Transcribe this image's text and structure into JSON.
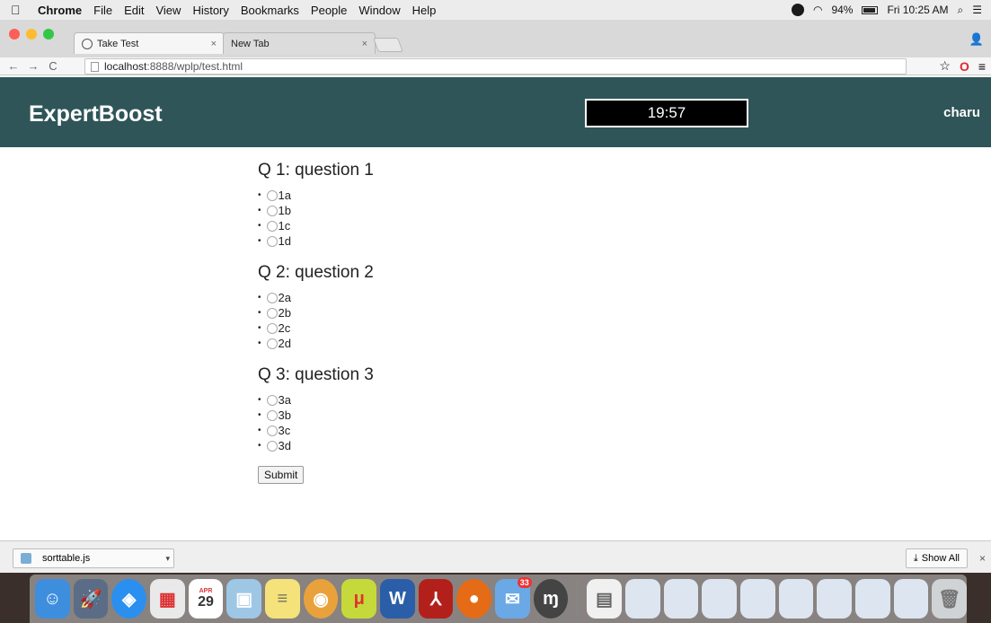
{
  "menubar": {
    "apple": "",
    "app": "Chrome",
    "items": [
      "File",
      "Edit",
      "View",
      "History",
      "Bookmarks",
      "People",
      "Window",
      "Help"
    ],
    "battery": "94%",
    "clock": "Fri 10:25 AM"
  },
  "tabs": [
    {
      "label": "Take Test",
      "close": "×"
    },
    {
      "label": "New Tab",
      "close": "×"
    }
  ],
  "omnibox": {
    "host": "localhost",
    "path": ":8888/wplp/test.html"
  },
  "site": {
    "brand": "ExpertBoost",
    "timer": "19:57",
    "user": "charu"
  },
  "questions": [
    {
      "title": "Q 1: question 1",
      "options": [
        "1a",
        "1b",
        "1c",
        "1d"
      ]
    },
    {
      "title": "Q 2: question 2",
      "options": [
        "2a",
        "2b",
        "2c",
        "2d"
      ]
    },
    {
      "title": "Q 3: question 3",
      "options": [
        "3a",
        "3b",
        "3c",
        "3d"
      ]
    }
  ],
  "submit_label": "Submit",
  "shelf": {
    "file": "sorttable.js",
    "show_all": "Show All",
    "close": "×"
  },
  "dock": {
    "icons": [
      "finder-icon",
      "launchpad-icon",
      "safari-icon",
      "calculator-icon",
      "calendar-icon",
      "preview-icon",
      "notes-icon",
      "chrome-icon",
      "bittorrent-icon",
      "word-icon",
      "acrobat-icon",
      "firefox-icon",
      "mail-icon",
      "mendeley-icon",
      "document-icon",
      "window-thumb-icon",
      "window-thumb-icon",
      "window-thumb-icon",
      "window-thumb-icon",
      "window-thumb-icon",
      "window-thumb-icon",
      "window-thumb-icon",
      "window-thumb-icon",
      "trash-icon"
    ],
    "calendar_day": "29",
    "calendar_month": "APR",
    "mail_badge": "33"
  }
}
